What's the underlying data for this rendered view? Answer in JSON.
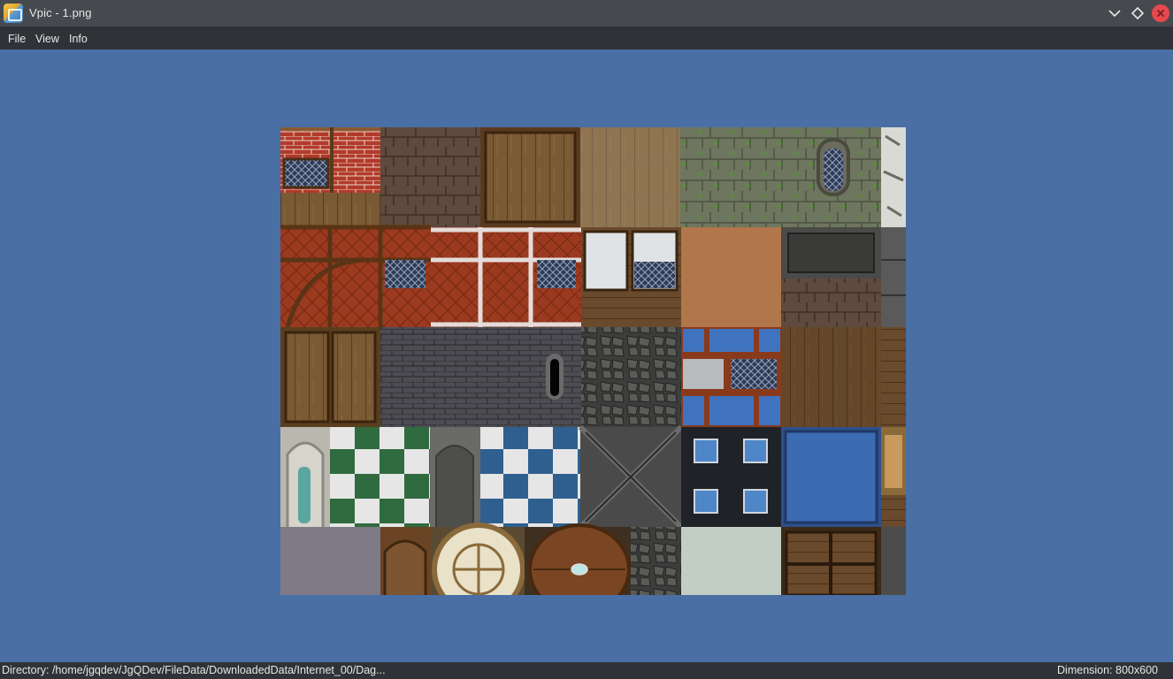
{
  "window": {
    "title": "Vpic - 1.png",
    "icon": "image-viewer-app-icon",
    "controls": [
      "chevron-down-icon",
      "diamond-maximize-icon",
      "close-icon"
    ]
  },
  "menu": {
    "file": "File",
    "view": "View",
    "info": "Info"
  },
  "status": {
    "directory": "Directory: /home/jgqdev/JgQDev/FileData/DownloadedData/Internet_00/Dag...",
    "dimension": "Dimension: 800x600"
  },
  "colors": {
    "titlebar": "#464a4f",
    "menubar": "#2f3236",
    "canvas": "#4a6fa5",
    "close": "#e5484d"
  }
}
